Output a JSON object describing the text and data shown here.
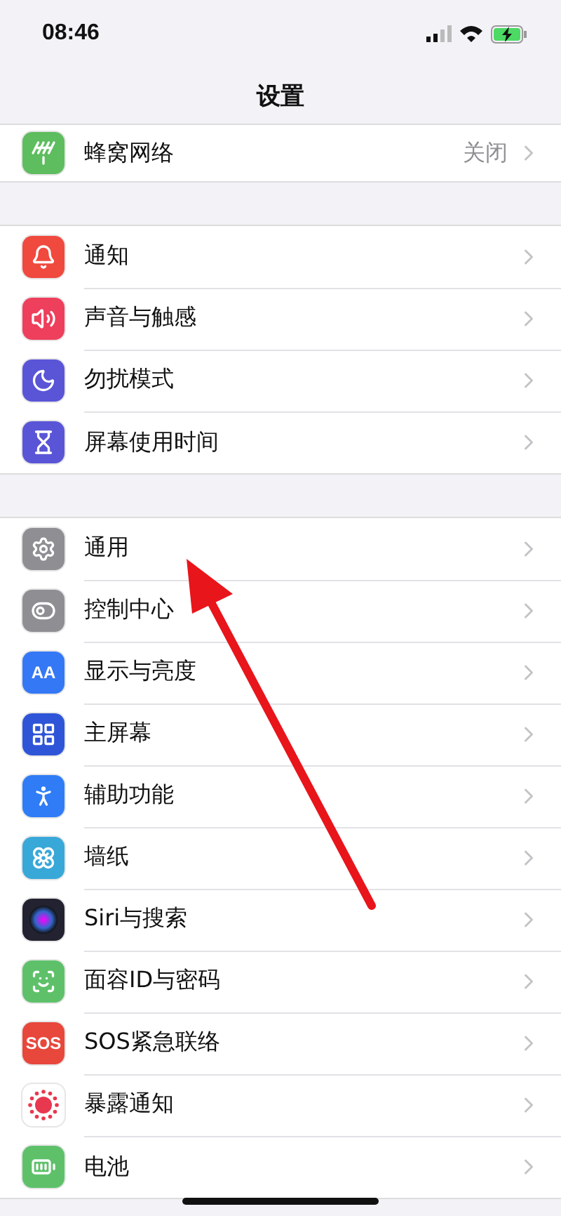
{
  "status_bar": {
    "time": "08:46"
  },
  "nav": {
    "title": "设置"
  },
  "sections": [
    {
      "rows": [
        {
          "label": "蜂窝网络",
          "value": "关闭",
          "color": "#5ebd5e"
        }
      ]
    },
    {
      "rows": [
        {
          "label": "通知",
          "color": "#f0493e"
        },
        {
          "label": "声音与触感",
          "color": "#ee3f5d"
        },
        {
          "label": "勿扰模式",
          "color": "#5a55d6"
        },
        {
          "label": "屏幕使用时间",
          "color": "#5a55d6"
        }
      ]
    },
    {
      "rows": [
        {
          "label": "通用",
          "color": "#8e8e93"
        },
        {
          "label": "控制中心",
          "color": "#8e8e93"
        },
        {
          "label": "显示与亮度",
          "color": "#3478f6",
          "icon_text": "AA"
        },
        {
          "label": "主屏幕",
          "color": "#2e55d8"
        },
        {
          "label": "辅助功能",
          "color": "#2f7cf6"
        },
        {
          "label": "墙纸",
          "color": "#38a8d8"
        },
        {
          "label": "Siri与搜索",
          "color": "#222230"
        },
        {
          "label": "面容ID与密码",
          "color": "#5ec16a"
        },
        {
          "label": "SOS紧急联络",
          "color": "#e8473c",
          "icon_text": "SOS"
        },
        {
          "label": "暴露通知",
          "color": "#ffffff"
        },
        {
          "label": "电池",
          "color": "#5ec16a"
        }
      ]
    }
  ]
}
